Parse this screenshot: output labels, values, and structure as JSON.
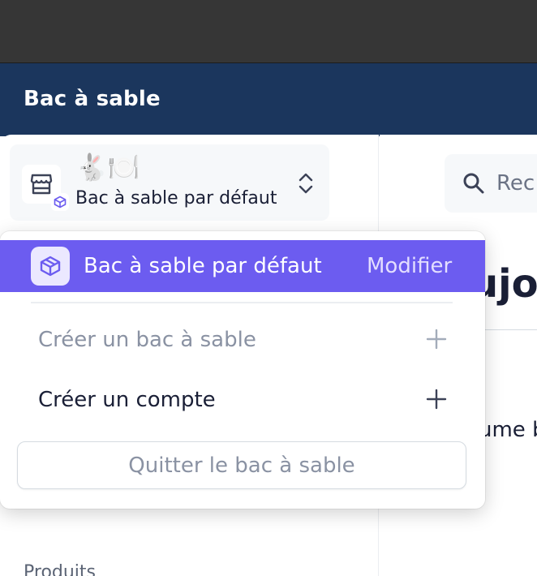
{
  "header": {
    "sandbox_title": "Bac à sable"
  },
  "account_switcher": {
    "emoji": "🐇🍽️",
    "name": "Bac à sable par défaut",
    "icons": [
      "store-icon",
      "box-icon",
      "chevron-updown-icon"
    ]
  },
  "search": {
    "placeholder_partial": "Rec"
  },
  "main": {
    "heading_partial": "ujo",
    "summary_partial": "ume b"
  },
  "dropdown": {
    "selected": {
      "label": "Bac à sable par défaut",
      "edit_label": "Modifier"
    },
    "create_sandbox": "Créer un bac à sable",
    "create_account": "Créer un compte",
    "quit": "Quitter le bac à sable"
  },
  "sidebar": {
    "section_produits": "Produits"
  },
  "colors": {
    "chrome": "#363636",
    "sandbox_bar": "#1b365d",
    "accent": "#6c5cf0",
    "accent_light": "#ebe8ff",
    "text_primary": "#1a1f36",
    "text_muted": "#8a92a3"
  }
}
